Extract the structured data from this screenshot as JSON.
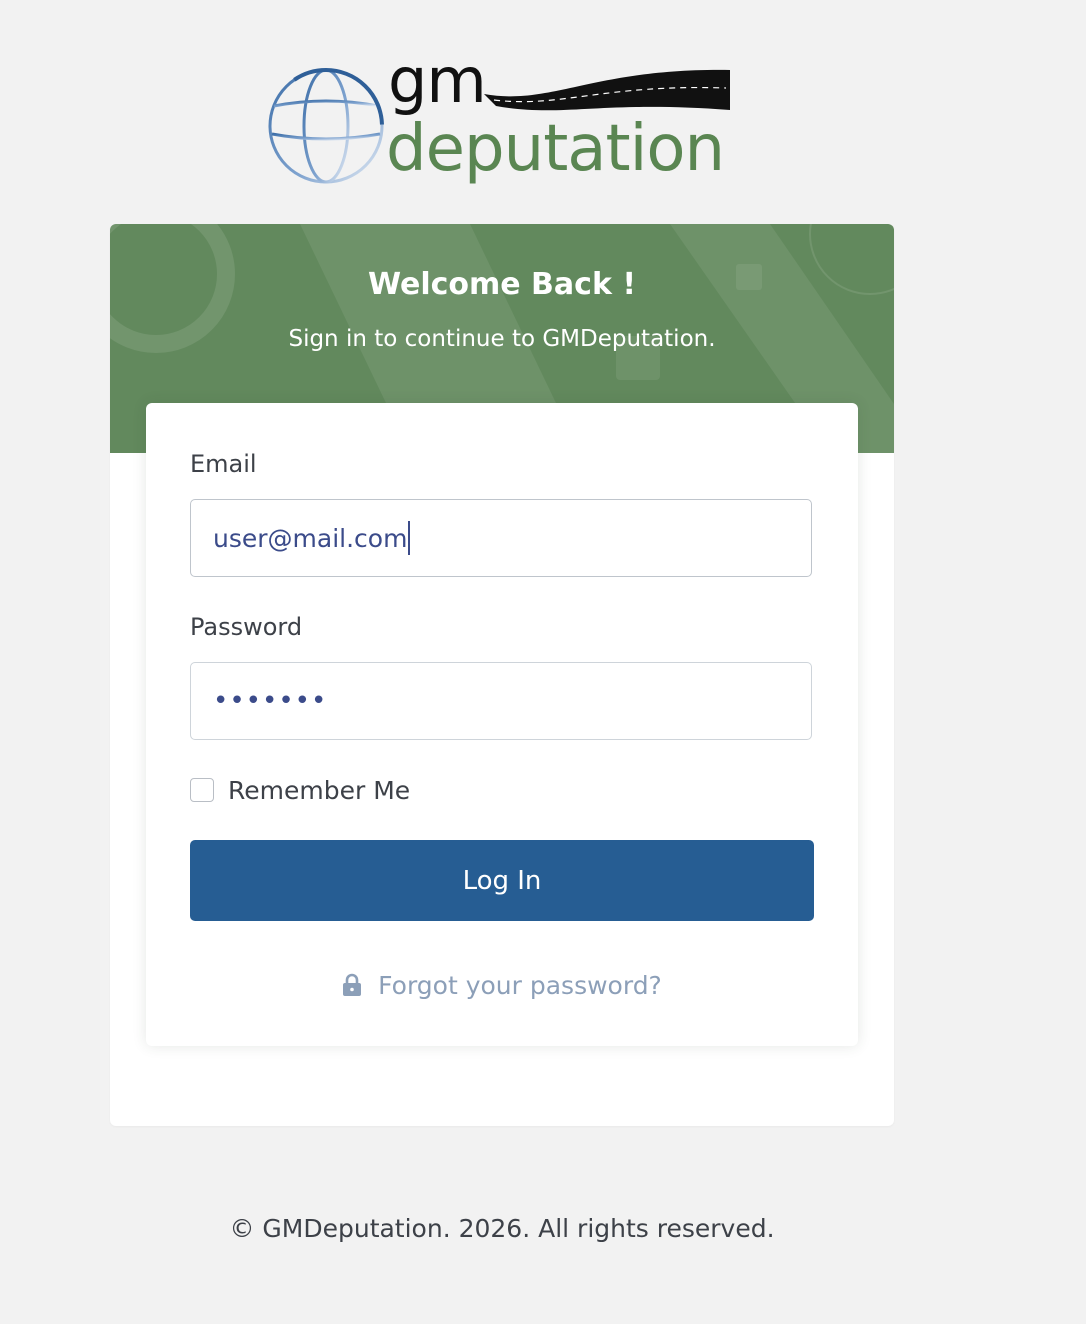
{
  "brand": {
    "logo_gm": "gm",
    "logo_deputation": "deputation",
    "accent_green": "#62895d",
    "logo_green": "#5a8652",
    "primary_blue": "#265d93"
  },
  "header": {
    "title": "Welcome Back !",
    "subtitle": "Sign in to continue to GMDeputation."
  },
  "form": {
    "email_label": "Email",
    "email_value": "user@mail.com",
    "password_label": "Password",
    "password_value": "•••••••",
    "remember_label": "Remember Me",
    "remember_checked": false,
    "login_label": "Log In",
    "forgot_icon": "lock-icon",
    "forgot_label": "Forgot your password?"
  },
  "footer": {
    "text": "© GMDeputation. 2026. All rights reserved."
  }
}
